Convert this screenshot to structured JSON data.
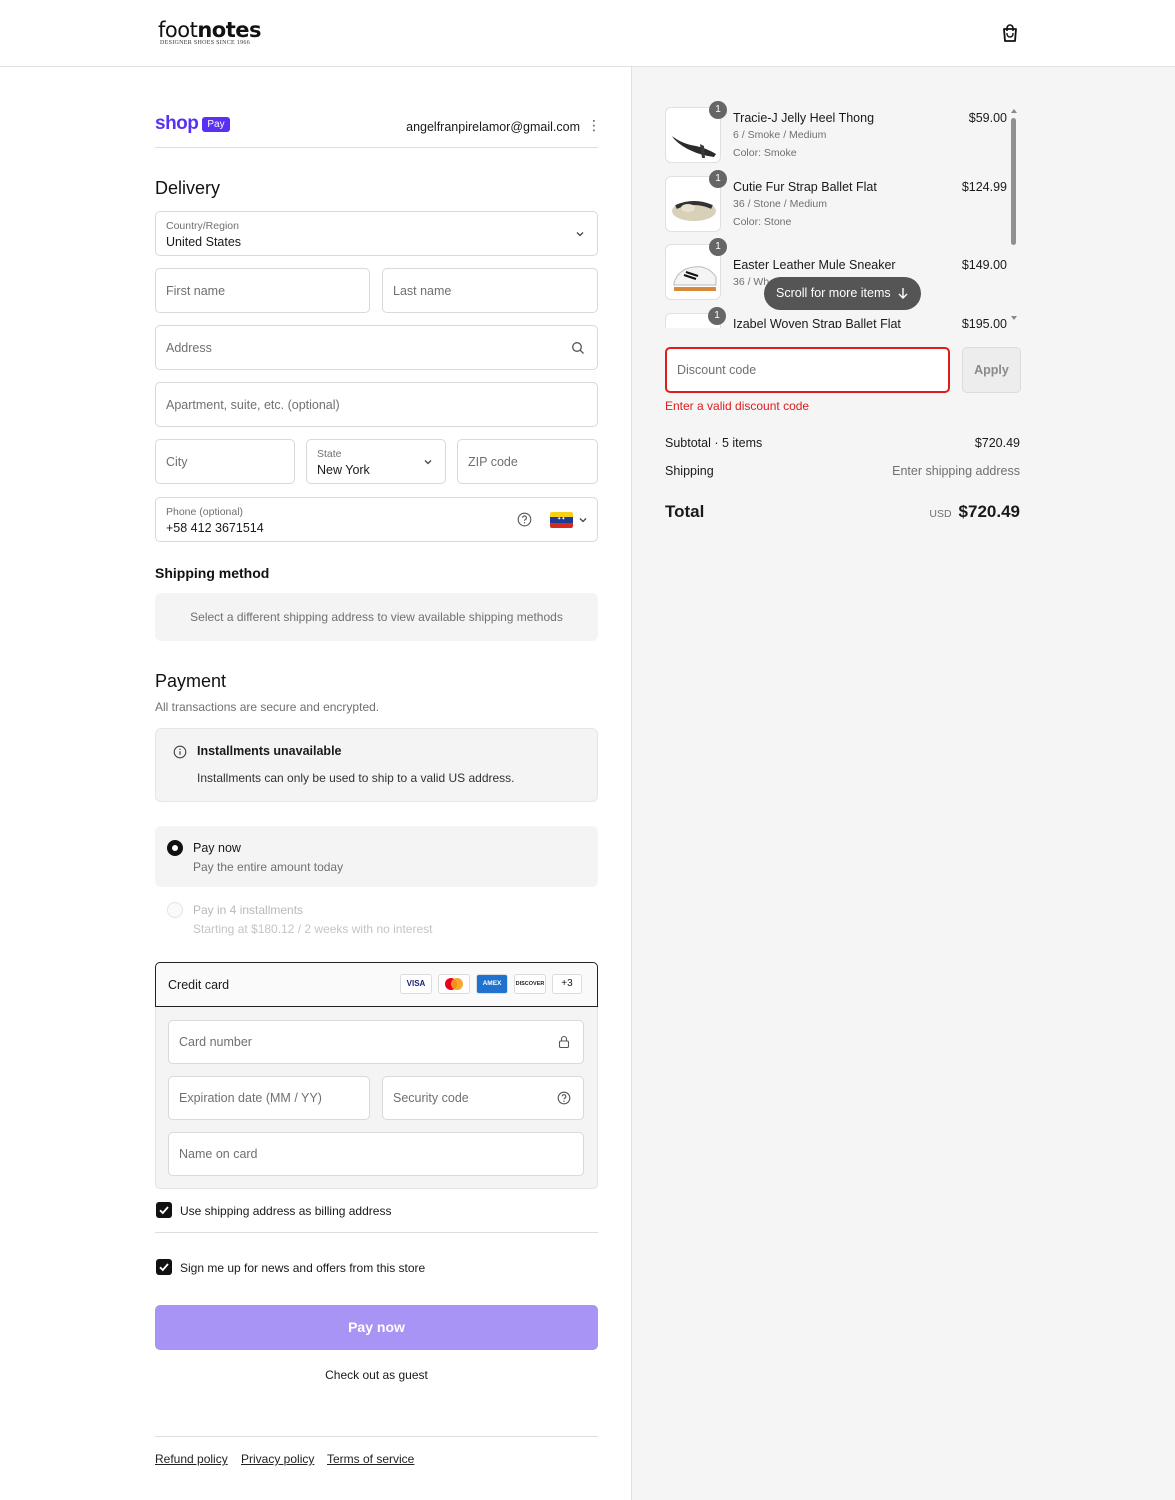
{
  "header": {
    "logo_main_light": "foot",
    "logo_main_bold": "notes",
    "logo_sub": "DESIGNER SHOES SINCE 1966"
  },
  "shop_pay": {
    "brand": "shop",
    "badge": "Pay",
    "email": "angelfranpirelamor@gmail.com"
  },
  "delivery": {
    "title": "Delivery",
    "country_label": "Country/Region",
    "country_value": "United States",
    "first_name_placeholder": "First name",
    "last_name_placeholder": "Last name",
    "address_placeholder": "Address",
    "apartment_placeholder": "Apartment, suite, etc. (optional)",
    "city_placeholder": "City",
    "state_label": "State",
    "state_value": "New York",
    "zip_placeholder": "ZIP code",
    "phone_label": "Phone (optional)",
    "phone_value": "+58 412 3671514"
  },
  "shipping_method": {
    "title": "Shipping method",
    "message": "Select a different shipping address to view available shipping methods"
  },
  "payment": {
    "title": "Payment",
    "subtitle": "All transactions are secure and encrypted.",
    "installments_title": "Installments unavailable",
    "installments_message": "Installments can only be used to ship to a valid US address.",
    "pay_now_label": "Pay now",
    "pay_now_sub": "Pay the entire amount today",
    "pay_installments_label": "Pay in 4 installments",
    "pay_installments_sub": "Starting at $180.12 / 2 weeks with no interest",
    "credit_card_label": "Credit card",
    "card_brands": [
      "VISA",
      "MC",
      "AMEX",
      "DISCOVER",
      "+3"
    ],
    "card_number_placeholder": "Card number",
    "expiry_placeholder": "Expiration date (MM / YY)",
    "security_placeholder": "Security code",
    "name_on_card_placeholder": "Name on card",
    "billing_checkbox": "Use shipping address as billing address",
    "newsletter_checkbox": "Sign me up for news and offers from this store",
    "pay_button": "Pay now",
    "guest_link": "Check out as guest"
  },
  "footer": {
    "refund": "Refund policy",
    "privacy": "Privacy policy",
    "terms": "Terms of service"
  },
  "cart": {
    "items": [
      {
        "qty": "1",
        "name": "Tracie-J Jelly Heel Thong",
        "variant": "6 / Smoke / Medium",
        "color": "Color: Smoke",
        "price": "$59.00"
      },
      {
        "qty": "1",
        "name": "Cutie Fur Strap Ballet Flat",
        "variant": "36 / Stone / Medium",
        "color": "Color: Stone",
        "price": "$124.99"
      },
      {
        "qty": "1",
        "name": "Easter Leather Mule Sneaker",
        "variant": "36 / Wh",
        "color": "",
        "price": "$149.00"
      },
      {
        "qty": "1",
        "name": "Izabel Woven Strap Ballet Flat",
        "variant": "",
        "color": "",
        "price": "$195.00"
      }
    ],
    "scroll_hint": "Scroll for more items",
    "discount_placeholder": "Discount code",
    "apply_button": "Apply",
    "discount_error": "Enter a valid discount code",
    "subtotal_label": "Subtotal · 5 items",
    "subtotal_value": "$720.49",
    "shipping_label": "Shipping",
    "shipping_value": "Enter shipping address",
    "total_label": "Total",
    "total_currency": "USD",
    "total_value": "$720.49"
  },
  "colors": {
    "shop_pay_purple": "#5a31f4",
    "pay_button": "#a894f5",
    "error_red": "#dd1d1d"
  }
}
